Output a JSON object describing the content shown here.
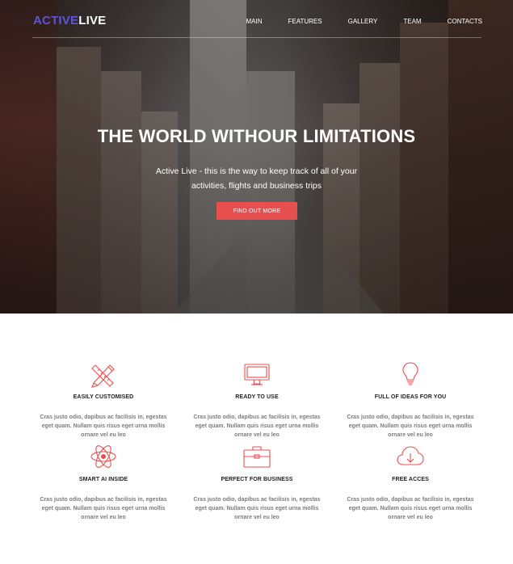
{
  "brand": {
    "part1": "ACTIVE",
    "part2": "LIVE"
  },
  "nav": {
    "items": [
      "MAIN",
      "FEATURES",
      "GALLERY",
      "TEAM",
      "CONTACTS"
    ]
  },
  "hero": {
    "title": "THE WORLD WITHOUR LIMITATIONS",
    "subtitle": "Active Live - this is the way to keep track of all of your activities, flights and business trips",
    "button": "FIND OUT MORE"
  },
  "colors": {
    "accent": "#e84f4f",
    "brand": "#5c55d6"
  },
  "features": [
    {
      "icon": "pencil-ruler-icon",
      "title": "EASILY CUSTOMISED",
      "text": "Cras justo odio, dapibus ac facilisis in, egestas eget quam. Nullam quis risus eget urna mollis ornare vel eu leo"
    },
    {
      "icon": "monitor-icon",
      "title": "READY TO USE",
      "text": "Cras justo odio, dapibus ac facilisis in, egestas eget quam. Nullam quis risus eget urna mollis ornare vel eu leo"
    },
    {
      "icon": "lightbulb-icon",
      "title": "FULL OF IDEAS FOR YOU",
      "text": "Cras justo odio, dapibus ac facilisis in, egestas eget quam. Nullam quis risus eget urna mollis ornare vel eu leo"
    },
    {
      "icon": "atom-icon",
      "title": "SMART AI INSIDE",
      "text": "Cras justo odio, dapibus ac facilisis in, egestas eget quam. Nullam quis risus eget urna mollis ornare vel eu leo"
    },
    {
      "icon": "briefcase-icon",
      "title": "PERFECT FOR BUSINESS",
      "text": "Cras justo odio, dapibus ac facilisis in, egestas eget quam. Nullam quis risus eget urna mollis ornare vel eu leo"
    },
    {
      "icon": "cloud-download-icon",
      "title": "FREE ACCES",
      "text": "Cras justo odio, dapibus ac facilisis in, egestas eget quam. Nullam quis risus eget urna mollis ornare vel eu leo"
    }
  ]
}
